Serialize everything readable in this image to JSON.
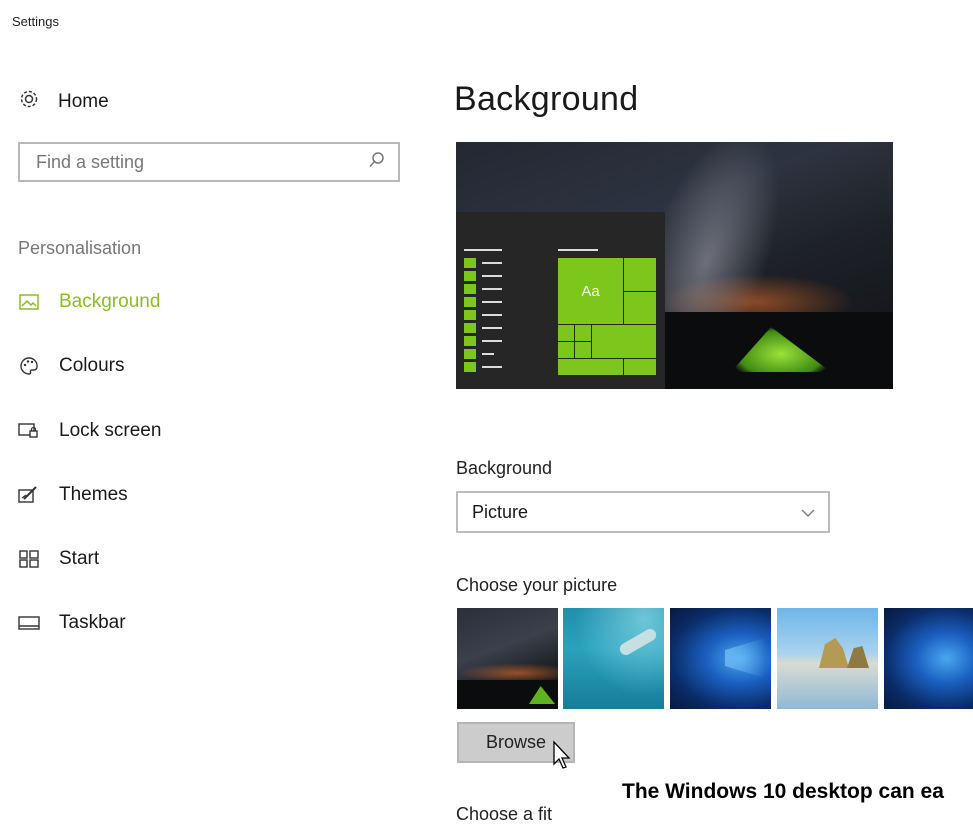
{
  "window": {
    "title": "Settings"
  },
  "sidebar": {
    "home_label": "Home",
    "search_placeholder": "Find a setting",
    "section_label": "Personalisation",
    "items": [
      {
        "label": "Background",
        "icon": "picture-icon",
        "active": true
      },
      {
        "label": "Colours",
        "icon": "palette-icon",
        "active": false
      },
      {
        "label": "Lock screen",
        "icon": "lock-screen-icon",
        "active": false
      },
      {
        "label": "Themes",
        "icon": "themes-icon",
        "active": false
      },
      {
        "label": "Start",
        "icon": "start-icon",
        "active": false
      },
      {
        "label": "Taskbar",
        "icon": "taskbar-icon",
        "active": false
      }
    ]
  },
  "main": {
    "title": "Background",
    "preview": {
      "tile_label": "Aa"
    },
    "background_label": "Background",
    "background_select_value": "Picture",
    "choose_picture_label": "Choose your picture",
    "thumbnails": [
      {
        "name": "night-sky-tent"
      },
      {
        "name": "underwater-swimmer"
      },
      {
        "name": "windows-blue-1"
      },
      {
        "name": "beach-rocks"
      },
      {
        "name": "windows-blue-2"
      }
    ],
    "browse_label": "Browse",
    "choose_fit_label": "Choose a fit"
  },
  "caption": "The Windows 10 desktop can ea",
  "colors": {
    "accent": "#8cbd1f",
    "tile": "#7dc61c"
  }
}
